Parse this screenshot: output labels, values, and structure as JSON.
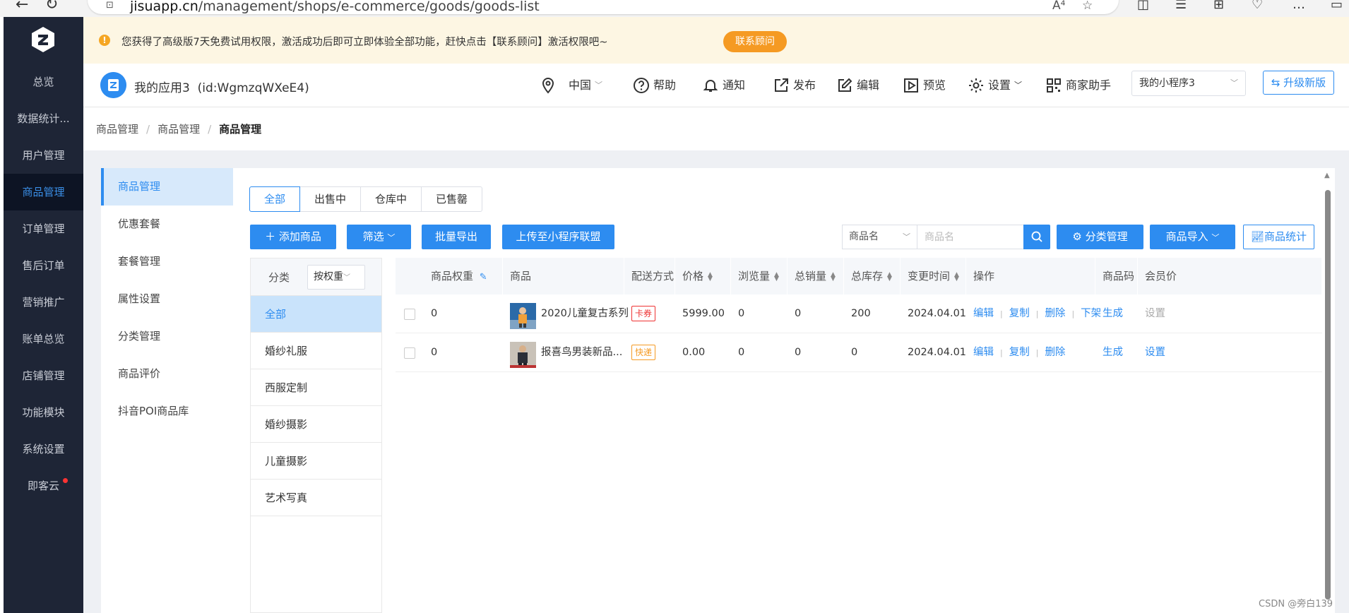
{
  "browser": {
    "url_host": "jisuapp.cn",
    "url_path": "/management/shops/e-commerce/goods/goods-list",
    "read_aloud": "A⁴"
  },
  "sidebar": {
    "items": [
      {
        "label": "总览"
      },
      {
        "label": "数据统计..."
      },
      {
        "label": "用户管理"
      },
      {
        "label": "商品管理",
        "active": true
      },
      {
        "label": "订单管理"
      },
      {
        "label": "售后订单"
      },
      {
        "label": "营销推广"
      },
      {
        "label": "账单总览"
      },
      {
        "label": "店铺管理"
      },
      {
        "label": "功能模块"
      },
      {
        "label": "系统设置"
      },
      {
        "label": "即客云",
        "badge": true
      }
    ]
  },
  "notice": {
    "text": "您获得了高级版7天免费试用权限，激活成功后即可立即体验全部功能，赶快点击【联系顾问】激活权限吧~",
    "button": "联系顾问"
  },
  "header": {
    "app_name": "我的应用3",
    "app_id": "(id:WgmzqWXeE4)",
    "region": "中国",
    "help": "帮助",
    "notify": "通知",
    "publish": "发布",
    "edit": "编辑",
    "preview": "预览",
    "settings": "设置",
    "merchant_helper": "商家助手",
    "mini_program": "我的小程序3",
    "upgrade": "升级新版"
  },
  "breadcrumb": [
    "商品管理",
    "商品管理",
    "商品管理"
  ],
  "subnav": {
    "items": [
      {
        "label": "商品管理",
        "active": true
      },
      {
        "label": "优惠套餐"
      },
      {
        "label": "套餐管理"
      },
      {
        "label": "属性设置"
      },
      {
        "label": "分类管理"
      },
      {
        "label": "商品评价"
      },
      {
        "label": "抖音POI商品库"
      }
    ]
  },
  "tabs": [
    {
      "label": "全部",
      "active": true
    },
    {
      "label": "出售中"
    },
    {
      "label": "仓库中"
    },
    {
      "label": "已售罄"
    }
  ],
  "toolbar": {
    "add": "添加商品",
    "filter": "筛选",
    "export": "批量导出",
    "upload": "上传至小程序联盟",
    "search_field": "商品名",
    "search_placeholder": "商品名",
    "category_mgmt": "分类管理",
    "import": "商品导入",
    "stats": "商品统计"
  },
  "categories": {
    "header": "分类",
    "sort": "按权重",
    "items": [
      {
        "label": "全部",
        "active": true
      },
      {
        "label": "婚纱礼服"
      },
      {
        "label": "西服定制"
      },
      {
        "label": "婚纱摄影"
      },
      {
        "label": "儿童摄影"
      },
      {
        "label": "艺术写真"
      }
    ]
  },
  "table": {
    "columns": {
      "weight": "商品权重",
      "product": "商品",
      "delivery": "配送方式",
      "price": "价格",
      "views": "浏览量",
      "sales": "总销量",
      "stock": "总库存",
      "updated": "变更时间",
      "actions": "操作",
      "code": "商品码",
      "member_price": "会员价"
    },
    "rows": [
      {
        "weight": "0",
        "name": "2020儿童复古系列",
        "delivery": "卡券",
        "price": "5999.00",
        "views": "0",
        "sales": "0",
        "stock": "200",
        "updated": "2024.04.01",
        "a1": "编辑",
        "a2": "复制",
        "a3": "删除",
        "a4": "下架",
        "code": "生成",
        "member": "设置"
      },
      {
        "weight": "0",
        "name": "报喜鸟男装新品...",
        "delivery": "快递",
        "price": "0.00",
        "views": "0",
        "sales": "0",
        "stock": "0",
        "updated": "2024.04.01",
        "a1": "编辑",
        "a2": "复制",
        "a3": "删除",
        "code": "生成",
        "member": "设置"
      }
    ]
  },
  "watermark": "CSDN @旁白139",
  "colors": {
    "sidebar_bg": "#1e2536",
    "accent": "#2d8cf0",
    "notice_bg": "#fdf6e3",
    "notice_btn": "#f59a23"
  }
}
